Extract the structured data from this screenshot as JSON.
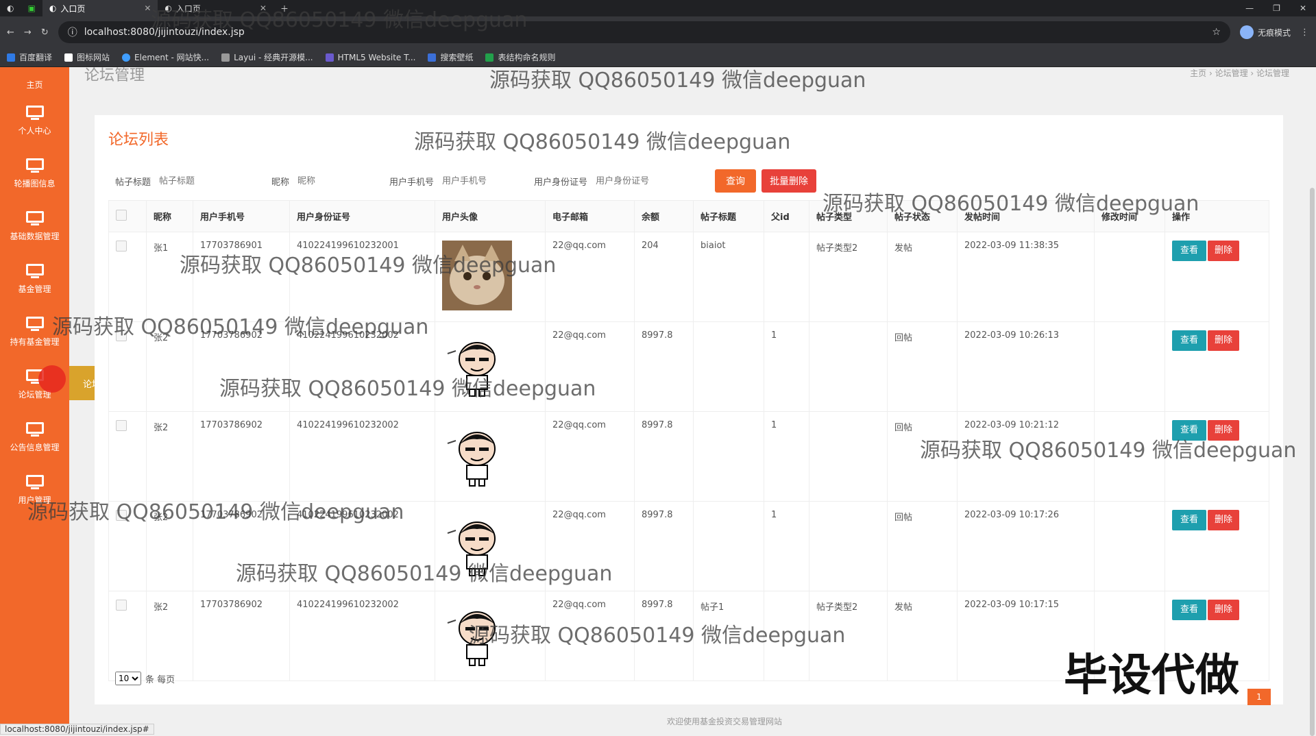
{
  "browser": {
    "tabs": [
      {
        "label": ""
      },
      {
        "label": ""
      },
      {
        "label": "入口页",
        "active": true
      },
      {
        "label": "入口页"
      }
    ],
    "url": "localhost:8080/jijintouzi/index.jsp",
    "incognito_label": "无痕模式",
    "bookmarks": [
      "百度翻译",
      "图标网站",
      "Element - 网站快...",
      "Layui - 经典开源模...",
      "HTML5 Website T...",
      "搜索壁纸",
      "表结构命名规则"
    ]
  },
  "sidebar": {
    "items": [
      {
        "label": "主页"
      },
      {
        "label": "个人中心"
      },
      {
        "label": "轮播图信息"
      },
      {
        "label": "基础数据管理"
      },
      {
        "label": "基金管理"
      },
      {
        "label": "持有基金管理"
      },
      {
        "label": "论坛管理"
      },
      {
        "label": "公告信息管理"
      },
      {
        "label": "用户管理"
      }
    ],
    "popup_label": "论坛管理"
  },
  "header": {
    "title": "论坛管理",
    "breadcrumb": "主页 › 论坛管理 › 论坛管理"
  },
  "main": {
    "card_title": "论坛列表",
    "search": {
      "fields": [
        {
          "label": "帖子标题",
          "placeholder": "帖子标题"
        },
        {
          "label": "昵称",
          "placeholder": "昵称"
        },
        {
          "label": "用户手机号",
          "placeholder": "用户手机号"
        },
        {
          "label": "用户身份证号",
          "placeholder": "用户身份证号"
        }
      ],
      "query_button": "查询",
      "batch_delete_button": "批量删除"
    },
    "table": {
      "columns": [
        "昵称",
        "用户手机号",
        "用户身份证号",
        "用户头像",
        "电子邮箱",
        "余额",
        "帖子标题",
        "父id",
        "帖子类型",
        "帖子状态",
        "发帖时间",
        "修改时间",
        "操作"
      ],
      "rows": [
        {
          "nickname": "张1",
          "phone": "17703786901",
          "idcard": "410224199610232001",
          "avatar": "cat",
          "email": "22@qq.com",
          "balance": "204",
          "post_title": "biaiot",
          "parent_id": "",
          "post_type": "帖子类型2",
          "post_status": "发帖",
          "post_time": "2022-03-09 11:38:35",
          "modify_time": ""
        },
        {
          "nickname": "张2",
          "phone": "17703786902",
          "idcard": "410224199610232002",
          "avatar": "cartoon",
          "email": "22@qq.com",
          "balance": "8997.8",
          "post_title": "",
          "parent_id": "1",
          "post_type": "",
          "post_status": "回帖",
          "post_time": "2022-03-09 10:26:13",
          "modify_time": ""
        },
        {
          "nickname": "张2",
          "phone": "17703786902",
          "idcard": "410224199610232002",
          "avatar": "cartoon",
          "email": "22@qq.com",
          "balance": "8997.8",
          "post_title": "",
          "parent_id": "1",
          "post_type": "",
          "post_status": "回帖",
          "post_time": "2022-03-09 10:21:12",
          "modify_time": ""
        },
        {
          "nickname": "张2",
          "phone": "17703786902",
          "idcard": "410224199610232002",
          "avatar": "cartoon",
          "email": "22@qq.com",
          "balance": "8997.8",
          "post_title": "",
          "parent_id": "1",
          "post_type": "",
          "post_status": "回帖",
          "post_time": "2022-03-09 10:17:26",
          "modify_time": ""
        },
        {
          "nickname": "张2",
          "phone": "17703786902",
          "idcard": "410224199610232002",
          "avatar": "cartoon",
          "email": "22@qq.com",
          "balance": "8997.8",
          "post_title": "帖子1",
          "parent_id": "",
          "post_type": "帖子类型2",
          "post_status": "发帖",
          "post_time": "2022-03-09 10:17:15",
          "modify_time": ""
        }
      ],
      "view_label": "查看",
      "delete_label": "删除"
    },
    "pager": {
      "page_size": "10",
      "suffix": "条 每页",
      "current_page": "1"
    }
  },
  "footer": "欢迎使用基金投资交易管理网站",
  "status_url": "localhost:8080/jijintouzi/index.jsp#",
  "overlay_text": "毕设代做",
  "watermark": "源码获取 QQ86050149 微信deepguan",
  "colors": {
    "primary": "#f2682a",
    "danger": "#e8413a",
    "view": "#1e9fae",
    "popup": "#d9a32c"
  }
}
